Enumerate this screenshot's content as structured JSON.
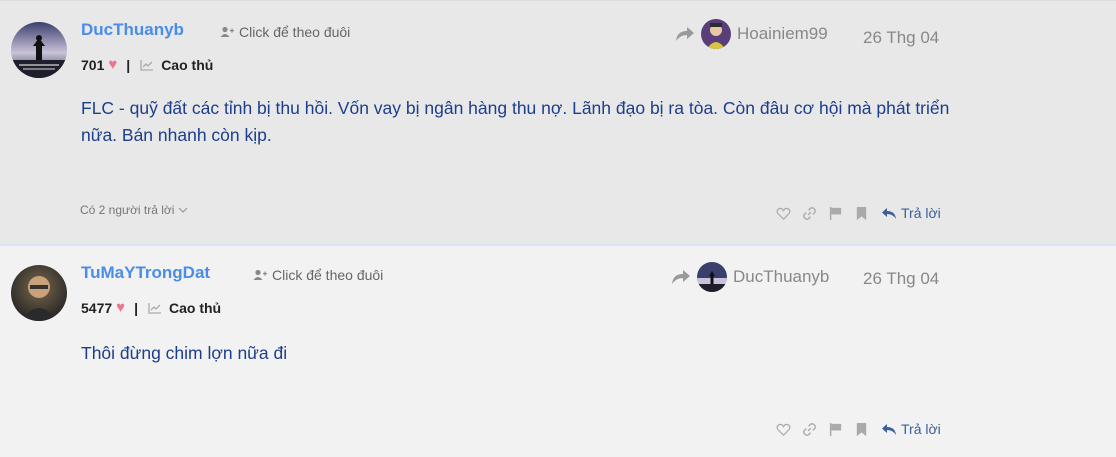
{
  "posts": [
    {
      "username": "DucThuanyb",
      "follow_label": "Click để theo đuôi",
      "likes": "701",
      "rank": "Cao thủ",
      "reply_to": "Hoainiem99",
      "date": "26 Thg 04",
      "content": "FLC - quỹ đất các tỉnh bị thu hồi. Vốn vay bị ngân hàng thu nợ. Lãnh đạo bị ra tòa. Còn đâu cơ hội mà phát triển nữa. Bán nhanh còn kịp.",
      "replies_label": "Có 2 người trả lời",
      "reply_label": "Trả lời"
    },
    {
      "username": "TuMaYTrongDat",
      "follow_label": "Click để theo đuôi",
      "likes": "5477",
      "rank": "Cao thủ",
      "reply_to": "DucThuanyb",
      "date": "26 Thg 04",
      "content": "Thôi đừng chim lợn nữa đi",
      "reply_label": "Trả lời"
    }
  ],
  "icons": {
    "follow": "user-plus-icon",
    "like": "heart-icon",
    "rank": "chart-icon",
    "share": "share-arrow-icon",
    "love": "heart-outline-icon",
    "link": "link-icon",
    "flag": "flag-icon",
    "bookmark": "bookmark-icon",
    "reply": "reply-icon",
    "chevron": "chevron-down-icon"
  },
  "colors": {
    "username": "#4a8de8",
    "content": "#1c3e8c",
    "heart": "#f0758f",
    "reply": "#3b5f9a"
  }
}
